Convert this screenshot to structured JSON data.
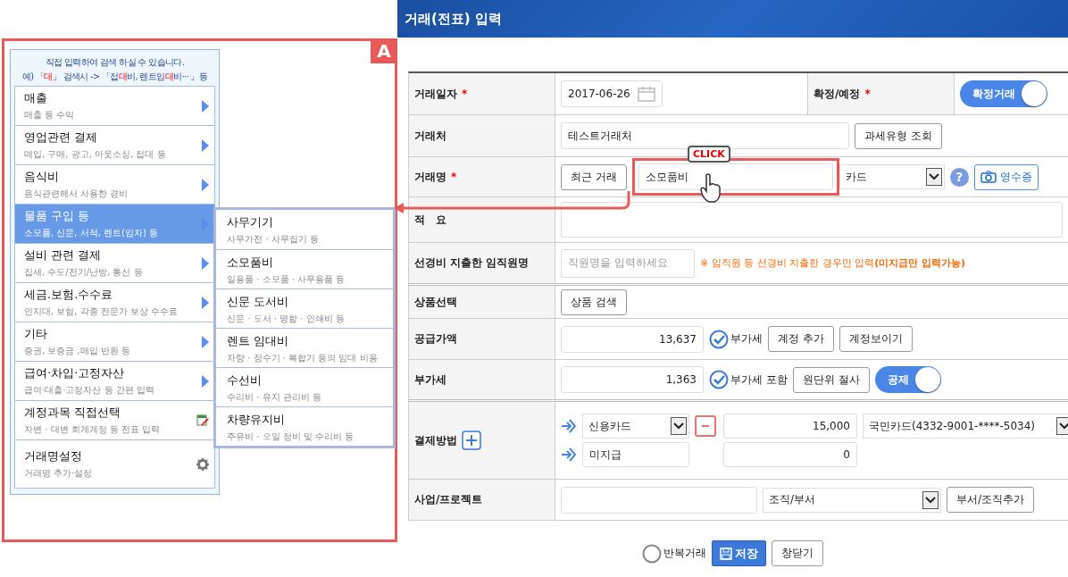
{
  "window": {
    "title": "거래(전표) 입력"
  },
  "guide": {
    "badge": "A",
    "callout": "CLICK"
  },
  "menu": {
    "hint": "직접 입력하여 검색 하실 수 있습니다.",
    "example": "예) 「**대**」 검색시 -> 「접**대**비, 렌트임**대**비··· 」등",
    "items": [
      {
        "kind": "submenu",
        "title": "매출",
        "subtitle": "매출 등 수익",
        "selected": false
      },
      {
        "kind": "submenu",
        "title": "영업관련 결제",
        "subtitle": "매입, 구매, 광고, 아웃소싱, 접대 등",
        "selected": false
      },
      {
        "kind": "submenu",
        "title": "음식비",
        "subtitle": "음식관련해서 사용한 경비",
        "selected": false
      },
      {
        "kind": "submenu",
        "title": "물품 구입 등",
        "subtitle": "소모품, 신문, 서적, 렌트(임차) 등",
        "selected": true
      },
      {
        "kind": "submenu",
        "title": "설비 관련 결제",
        "subtitle": "집세, 수도/전기/난방, 통신 등",
        "selected": false
      },
      {
        "kind": "submenu",
        "title": "세금.보험.수수료",
        "subtitle": "인지대, 보험, 각종 전문가 보상 수수료",
        "selected": false
      },
      {
        "kind": "submenu",
        "title": "기타",
        "subtitle": "증권, 보증금 ,매입 반환 등",
        "selected": false
      },
      {
        "kind": "submenu",
        "title": "급여·차입·고정자산",
        "subtitle": "급여·대출·고정자산 등 간편 입력",
        "selected": false
      },
      {
        "kind": "edit",
        "title": "계정과목 직접선택",
        "subtitle": "차변 · 대변 회계계정 등 전표 입력",
        "selected": false
      },
      {
        "kind": "settings",
        "title": "거래명설정",
        "subtitle": "거래명 추가·설정",
        "selected": false
      }
    ]
  },
  "submenu": {
    "items": [
      {
        "title": "사무기기",
        "subtitle": "사무가전 · 사무집기 등"
      },
      {
        "title": "소모품비",
        "subtitle": "일용품 · 소모품 · 사무용품 등"
      },
      {
        "title": "신문 도서비",
        "subtitle": "신문 · 도서 · 명함 · 인쇄비 등"
      },
      {
        "title": "렌트 임대비",
        "subtitle": "차량 · 정수기 · 복합기 등의 임대 비용"
      },
      {
        "title": "수선비",
        "subtitle": "수리비 · 유지 관리비 등"
      },
      {
        "title": "차량유지비",
        "subtitle": "주유비 · 오일 정비 및 수리비 등"
      }
    ]
  },
  "form": {
    "date": {
      "label": "거래일자",
      "mark": "*",
      "value": "2017-06-26"
    },
    "status": {
      "label": "확정/예정",
      "mark": "*",
      "toggle": "확정거래",
      "on": true
    },
    "partner": {
      "label": "거래처",
      "value": "테스트거래처",
      "button": "과세유형 조회"
    },
    "title": {
      "label": "거래명",
      "mark": "*",
      "button": "최근 거래",
      "value": "소모품비",
      "select": "카드",
      "help": "?",
      "receipt": "영수증"
    },
    "memo": {
      "label": "적　요"
    },
    "employee": {
      "label": "선경비 지출한 임직원명",
      "placeholder": "직원명을 입력하세요",
      "note": "※ 임직원 등 선경비 지출한 경우만 입력**(미지급만 입력가능)**"
    },
    "product": {
      "label": "상품선택",
      "button": "상품 검색"
    },
    "supply": {
      "label": "공급가액",
      "value": "13,637",
      "check": "부가세",
      "checked": true,
      "buttons": [
        "계정 추가",
        "계정보이기"
      ]
    },
    "vat": {
      "label": "부가세",
      "value": "1,363",
      "check": "부가세 포함",
      "checked": true,
      "button": "원단위 절사",
      "toggle": "공제",
      "on": true
    },
    "payment": {
      "label": "결제방법",
      "lines": [
        {
          "kind": "select",
          "method": "신용카드",
          "amount": "15,000",
          "card": "국민카드(4332-9001-****-5034)"
        },
        {
          "kind": "text",
          "method": "미지급",
          "amount": "0"
        }
      ]
    },
    "project": {
      "label": "사업/프로젝트",
      "select": "조직/부서",
      "button": "부서/조직추가"
    }
  },
  "actions": {
    "repeat": "반복거래",
    "repeat_checked": false,
    "save": "저장",
    "close": "창닫기"
  }
}
